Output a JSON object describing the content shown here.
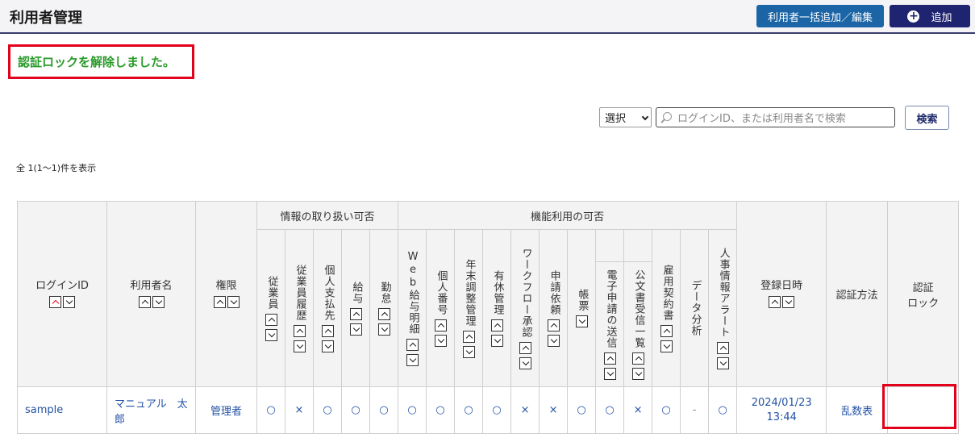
{
  "header": {
    "title": "利用者管理",
    "bulk_button": "利用者一括追加／編集",
    "add_button": "追加",
    "add_icon": "plus-circle-icon"
  },
  "message": "認証ロックを解除しました。",
  "search": {
    "select_value": "選択",
    "placeholder": "ログインID、または利用者名で検索",
    "button": "検索"
  },
  "count_text": "全 1(1～1)件を表示",
  "table": {
    "group_info": "情報の取り扱い可否",
    "group_func": "機能利用の可否",
    "headers": {
      "login_id": "ログインID",
      "user_name": "利用者名",
      "role": "権限",
      "info": [
        "従業員",
        "従業員履歴",
        "個人支払先",
        "給与",
        "勤怠"
      ],
      "func": [
        "Web給与明細",
        "個人番号",
        "年末調整管理",
        "有休管理",
        "ワークフロー承認",
        "申請依頼",
        "帳票",
        "電子申請の送信",
        "公文書受信一覧",
        "雇用契約書",
        "データ分析",
        "人事情報アラート"
      ],
      "registered": "登録日時",
      "auth_method": "認証方法",
      "auth_lock_1": "認証",
      "auth_lock_2": "ロック"
    },
    "row": {
      "login_id": "sample",
      "user_name": "マニュアル　太郎",
      "role": "管理者",
      "info": [
        "○",
        "×",
        "○",
        "○",
        "○"
      ],
      "func": [
        "○",
        "○",
        "○",
        "○",
        "×",
        "×",
        "○",
        "○",
        "×",
        "○",
        "-",
        "○"
      ],
      "registered_date": "2024/01/23",
      "registered_time": "13:44",
      "auth_method": "乱数表",
      "auth_lock": ""
    }
  },
  "colors": {
    "accent": "#1f2470",
    "bulk_button": "#1b65a6",
    "success": "#2a9a2a",
    "highlight": "#e2001a",
    "link": "#2352a5"
  }
}
